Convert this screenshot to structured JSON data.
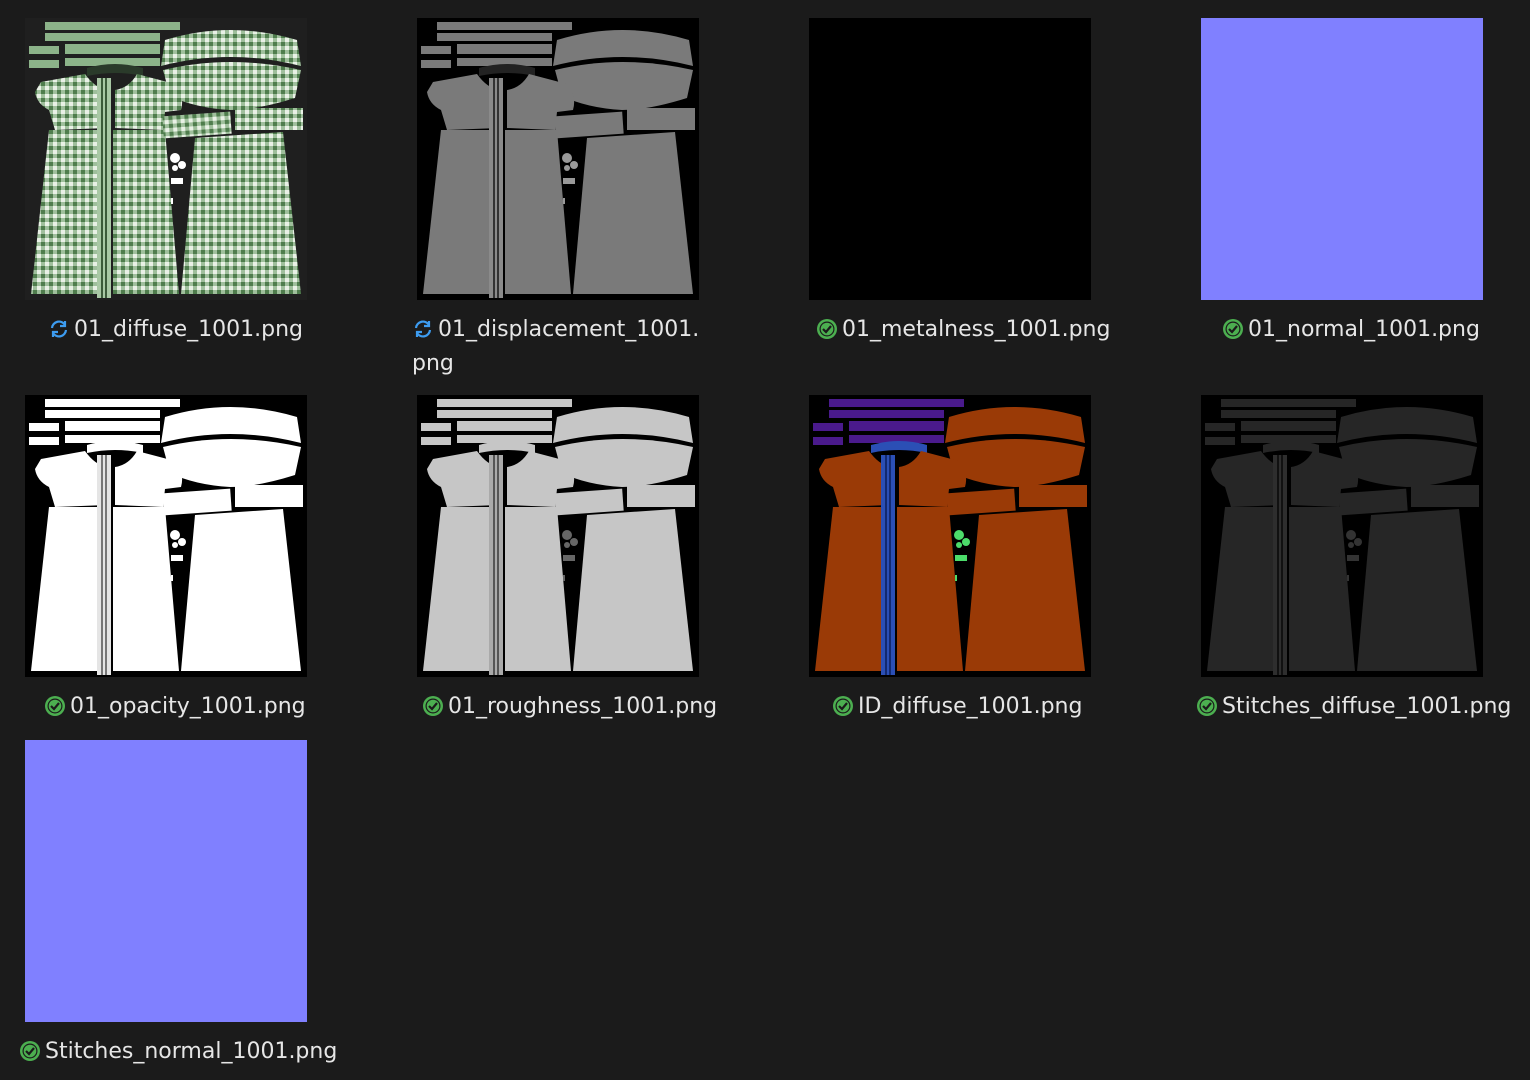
{
  "files": [
    {
      "name": "01_diffuse_1001.png",
      "status": "syncing",
      "kind": "diffuse"
    },
    {
      "name": "01_displacement_1001.png",
      "status": "syncing",
      "kind": "displacement"
    },
    {
      "name": "01_metalness_1001.png",
      "status": "synced",
      "kind": "metalness"
    },
    {
      "name": "01_normal_1001.png",
      "status": "synced",
      "kind": "normal"
    },
    {
      "name": "01_opacity_1001.png",
      "status": "synced",
      "kind": "opacity"
    },
    {
      "name": "01_roughness_1001.png",
      "status": "synced",
      "kind": "roughness"
    },
    {
      "name": "ID_diffuse_1001.png",
      "status": "synced",
      "kind": "id"
    },
    {
      "name": "Stitches_diffuse_1001.png",
      "status": "synced",
      "kind": "stitches"
    },
    {
      "name": "Stitches_normal_1001.png",
      "status": "synced",
      "kind": "normal"
    }
  ],
  "icons": {
    "syncing": "sync-arrows-icon",
    "synced": "green-check-circle-icon"
  },
  "colors": {
    "background": "#1b1b1b",
    "text": "#e6e6e6",
    "sync_blue": "#3d9cf0",
    "check_green": "#4caf50",
    "normal_map": "#8080ff",
    "diffuse_green": "#8cb389",
    "id_orange": "#9a3a06",
    "id_blue": "#2b4fb5",
    "id_purple": "#4a1a8c"
  }
}
